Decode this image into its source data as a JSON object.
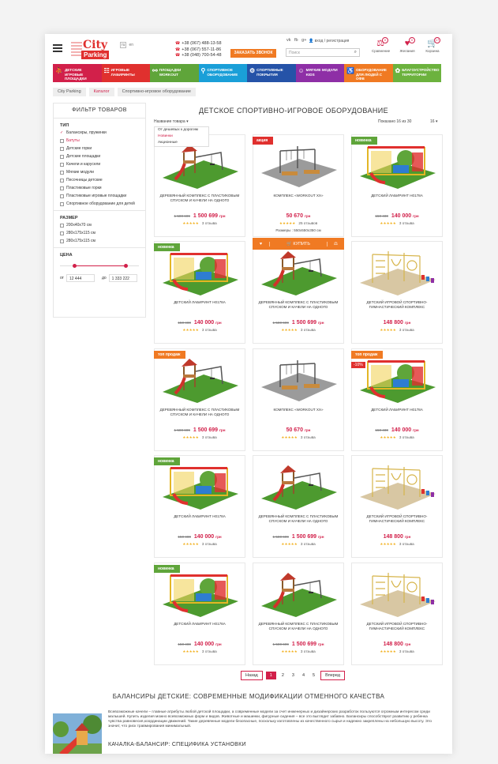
{
  "header": {
    "logo_top": "City",
    "logo_bottom": "Parking",
    "lang_ru": "ru",
    "lang_en": "en",
    "phones": [
      "+38 (067) 488-13-58",
      "+38 (067) 557-11-86",
      "+38 (048) 700-54-48"
    ],
    "call_button": "ЗАКАЗАТЬ ЗВОНОК",
    "social": "vk fb g+",
    "login": "вход / регистрация",
    "search_placeholder": "Поиск",
    "icons": [
      {
        "label": "Сравнение",
        "count": "0",
        "icon": "compare-icon"
      },
      {
        "label": "Желания",
        "count": "0",
        "icon": "heart-icon"
      },
      {
        "label": "Корзина",
        "count": "17",
        "icon": "cart-icon"
      }
    ]
  },
  "categories": [
    {
      "label": "Детские игровые площадки",
      "color": "#d2204a"
    },
    {
      "label": "Игровые лабиринты",
      "color": "#e0302e"
    },
    {
      "label": "Площадки Workout",
      "color": "#5fa53a"
    },
    {
      "label": "Спортивное оборудование",
      "color": "#1a9fd8"
    },
    {
      "label": "Спортивные покрытия",
      "color": "#2553a8"
    },
    {
      "label": "Мягкие модули KIDS",
      "color": "#8e2fa6"
    },
    {
      "label": "Оборудование для людей с ОФВ",
      "color": "#f07a23"
    },
    {
      "label": "Благоустройство территории",
      "color": "#6cb23e"
    }
  ],
  "breadcrumb": [
    "City Parking",
    "Каталог",
    "Спортивно-игровое оборудование"
  ],
  "filter": {
    "title": "ФИЛЬТР ТОВАРОВ",
    "type_heading": "ТИП",
    "types": [
      {
        "label": "Балансиры, пружинки",
        "state": "checked"
      },
      {
        "label": "Батуты",
        "state": "active"
      },
      {
        "label": "Детские горки",
        "state": ""
      },
      {
        "label": "Детские площадки",
        "state": ""
      },
      {
        "label": "Качели и карусели",
        "state": ""
      },
      {
        "label": "Мягкие модули",
        "state": ""
      },
      {
        "label": "Песочницы детские",
        "state": ""
      },
      {
        "label": "Пластиковые горки",
        "state": ""
      },
      {
        "label": "Пластиковые игровые площадки",
        "state": ""
      },
      {
        "label": "Спортивное оборудование для детей",
        "state": ""
      }
    ],
    "size_heading": "РАЗМЕР",
    "sizes": [
      "200х40х70 см",
      "280х175х115 см",
      "280х175х115 см"
    ],
    "price_heading": "ЦЕНА",
    "from_label": "от",
    "to_label": "до",
    "price_from": "12 444",
    "price_to": "1 333 222"
  },
  "main": {
    "title": "ДЕТСКОЕ СПОРТИВНО-ИГРОВОЕ ОБОРУДОВАНИЕ",
    "sort_label": "Название товара",
    "sort_options": [
      "От дешевых к дорогим",
      "Новинки",
      "Акционные"
    ],
    "shown": "Показано 16 из 30",
    "per_page": "16"
  },
  "products": [
    {
      "badge": "",
      "badge_type": "",
      "name": "Деревянный комплекс с пластиковым спуском и качели на одного",
      "old": "1 500 699",
      "price": "1 500 699",
      "cur": "грн",
      "reviews": "3 отзыва",
      "img": "wood-swing"
    },
    {
      "badge": "акция",
      "badge_type": "sale",
      "name": "Комплекс «Workout XX»",
      "old": "",
      "price": "50 670",
      "cur": "грн",
      "reviews": "25 отзывов",
      "dims": "Размеры : 550х550х350 см",
      "img": "workout",
      "hover": true
    },
    {
      "badge": "новинка",
      "badge_type": "new",
      "name": "Детский лабиринт H0178A",
      "old": "150 400",
      "price": "140 000",
      "cur": "грн",
      "reviews": "3 отзыва",
      "img": "maze"
    },
    {
      "badge": "новинка",
      "badge_type": "new",
      "name": "Детский лабиринт H0178A",
      "old": "150 400",
      "price": "140 000",
      "cur": "грн",
      "reviews": "3 отзыва",
      "img": "maze"
    },
    {
      "badge": "",
      "badge_type": "",
      "name": "Деревянный комплекс с пластиковым спуском и качели на одного",
      "old": "1 500 699",
      "price": "1 500 699",
      "cur": "грн",
      "reviews": "3 отзыва",
      "img": "wood-swing"
    },
    {
      "badge": "",
      "badge_type": "",
      "name": "Детский игровой спортивно-гимнастический комплекс",
      "old": "",
      "price": "148 800",
      "cur": "грн",
      "reviews": "3 отзыва",
      "img": "gym"
    },
    {
      "badge": "топ продаж",
      "badge_type": "top",
      "name": "Деревянный комплекс с пластиковым спуском и качели на одного",
      "old": "1 500 699",
      "price": "1 500 699",
      "cur": "грн",
      "reviews": "3 отзыва",
      "img": "wood-swing"
    },
    {
      "badge": "",
      "badge_type": "",
      "name": "Комплекс «Workout XX»",
      "old": "",
      "price": "50 670",
      "cur": "грн",
      "reviews": "3 отзыва",
      "img": "workout"
    },
    {
      "badge": "топ продаж",
      "badge_type": "top",
      "discount": "-10%",
      "name": "Детский лабиринт H0178A",
      "old": "150 400",
      "price": "140 000",
      "cur": "грн",
      "reviews": "3 отзыва",
      "img": "maze"
    },
    {
      "badge": "новинка",
      "badge_type": "new",
      "name": "Детский лабиринт H0178A",
      "old": "150 400",
      "price": "140 000",
      "cur": "грн",
      "reviews": "3 отзыва",
      "img": "maze"
    },
    {
      "badge": "",
      "badge_type": "",
      "name": "Деревянный комплекс с пластиковым спуском и качели на одного",
      "old": "1 500 699",
      "price": "1 500 699",
      "cur": "грн",
      "reviews": "3 отзыва",
      "img": "wood-swing"
    },
    {
      "badge": "",
      "badge_type": "",
      "name": "Детский игровой спортивно-гимнастический комплекс",
      "old": "",
      "price": "148 800",
      "cur": "грн",
      "reviews": "3 отзыва",
      "img": "gym"
    },
    {
      "badge": "новинка",
      "badge_type": "new",
      "name": "Детский лабиринт H0178A",
      "old": "150 400",
      "price": "140 000",
      "cur": "грн",
      "reviews": "3 отзыва",
      "img": "maze"
    },
    {
      "badge": "",
      "badge_type": "",
      "name": "Деревянный комплекс с пластиковым спуском и качели на одного",
      "old": "1 500 699",
      "price": "1 500 699",
      "cur": "грн",
      "reviews": "3 отзыва",
      "img": "wood-swing"
    },
    {
      "badge": "",
      "badge_type": "",
      "name": "Детский игровой спортивно-гимнастический комплекс",
      "old": "",
      "price": "148 800",
      "cur": "грн",
      "reviews": "3 отзыва",
      "img": "gym"
    }
  ],
  "stars": "★★★★★",
  "hover_bar": {
    "buy": "КУПИТЬ"
  },
  "pagination": {
    "prev": "Назад",
    "pages": [
      "1",
      "2",
      "3",
      "4",
      "5"
    ],
    "current": "1",
    "next": "Вперед"
  },
  "seo": {
    "title": "БАЛАНСИРЫ ДЕТСКИЕ: СОВРЕМЕННЫЕ МОДИФИКАЦИИ ОТМЕННОГО КАЧЕСТВА",
    "text": "Всевозможные качели – главные атрибуты любой детской площадки, а современные модели за счет инженерных и дизайнерских разработок пользуются огромным интересом среди малышей. Купить изделия можно всевозможных форм и видов. Животные и машинки, фигурные сидения – все это выглядит забавно. Балансиры способствуют развитию у ребенка чувства равновесия,координации движений. Такие деревянные модели безопасные, поскольку изготовлены из качественного сырья и надежно закреплены на небольшую высоту. Это значит, что риск травмирования минимальный.",
    "subtitle": "КАЧАЛКА-БАЛАНСИР: СПЕЦИФИКА УСТАНОВКИ"
  }
}
